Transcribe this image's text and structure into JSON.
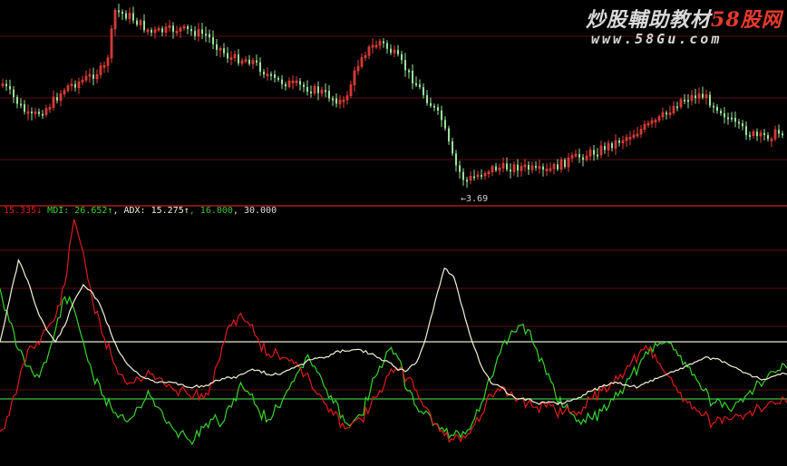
{
  "watermark": {
    "brand_main": "炒股輔助教材",
    "brand_accent": "58股网",
    "url": "www.58Gu.com"
  },
  "low_marker": "←3.69",
  "legend": {
    "pdi_value": "15.335↓",
    "mdi_label": " MDI: ",
    "mdi_value": "26.652↑",
    "adx_label": ", ADX: ",
    "adx_value": "15.275↑",
    "sep1": ", ",
    "level_low": "16.000",
    "sep2": ", ",
    "level_high": "30.000"
  },
  "colors": {
    "background": "#000000",
    "up": "#e8403a",
    "down": "#9be39b",
    "pdi": "#e01b1b",
    "mdi": "#37d52a",
    "adx": "#f3f3d8",
    "level_low": "#3cc03c",
    "level_high": "#e8e8d0",
    "divider": "#b01818",
    "grid": "#5a0f0f",
    "legend_text": "#dddddd"
  },
  "chart_data": [
    {
      "type": "candlestick",
      "title": "",
      "lowest_low": 3.69,
      "lowest_low_label": "←3.69",
      "grid": true
    },
    {
      "type": "line",
      "title": "",
      "ylim": [
        0,
        60
      ],
      "series": [
        {
          "name": "MDI",
          "values": [
            43,
            35,
            28,
            24,
            22,
            25,
            33,
            41,
            38,
            30,
            22,
            17,
            14,
            12,
            11,
            14,
            18,
            14,
            10,
            8,
            7,
            6,
            9,
            11,
            10,
            14,
            20,
            17,
            13,
            11,
            14,
            18,
            22,
            26,
            24,
            19,
            15,
            12,
            10,
            12,
            18,
            24,
            28,
            26,
            18,
            14,
            13,
            10,
            8,
            7,
            8,
            10,
            15,
            21,
            27,
            31,
            34,
            33,
            28,
            22,
            17,
            14,
            12,
            11,
            11,
            13,
            16,
            18,
            21,
            24,
            27,
            29,
            30,
            28,
            25,
            22,
            18,
            15,
            14,
            13,
            16,
            18,
            20,
            22,
            23,
            23.5
          ]
        },
        {
          "name": "ADX",
          "values": [
            30,
            40,
            50,
            45,
            38,
            33,
            30,
            34,
            40,
            44,
            42,
            38,
            32,
            27,
            24,
            22,
            21,
            20,
            20,
            20,
            19,
            19,
            19,
            20,
            21,
            21,
            22,
            23,
            23,
            22,
            22,
            23,
            24,
            25,
            26,
            26,
            27,
            28,
            28,
            28,
            27,
            26,
            25,
            23,
            23,
            25,
            31,
            40,
            48,
            46,
            38,
            30,
            24,
            20,
            19,
            17,
            16,
            16,
            15,
            15,
            15,
            15,
            16,
            17,
            18,
            19,
            20,
            20,
            19,
            19,
            20,
            21,
            22,
            23,
            24,
            25,
            26,
            26,
            25,
            24,
            23,
            22,
            21,
            21,
            22,
            22
          ]
        },
        {
          "name": "PDI",
          "values": [
            8,
            12,
            20,
            28,
            30,
            33,
            36,
            44,
            60,
            52,
            40,
            32,
            27,
            22,
            20,
            21,
            23,
            21,
            19,
            18,
            18,
            17,
            16,
            20,
            29,
            34,
            37,
            34,
            30,
            27,
            27,
            26,
            25,
            22,
            18,
            15,
            12,
            10,
            10,
            11,
            14,
            18,
            22,
            23,
            21,
            18,
            14,
            10,
            7,
            6,
            7,
            9,
            12,
            17,
            18,
            17,
            16,
            15,
            14,
            14,
            13,
            13,
            13,
            14,
            16,
            18,
            20,
            22,
            24,
            27,
            28,
            25,
            22,
            19,
            16,
            14,
            12,
            10,
            10,
            11,
            12,
            13,
            14,
            15,
            15,
            15
          ]
        }
      ],
      "hlines": [
        16,
        30
      ]
    }
  ]
}
